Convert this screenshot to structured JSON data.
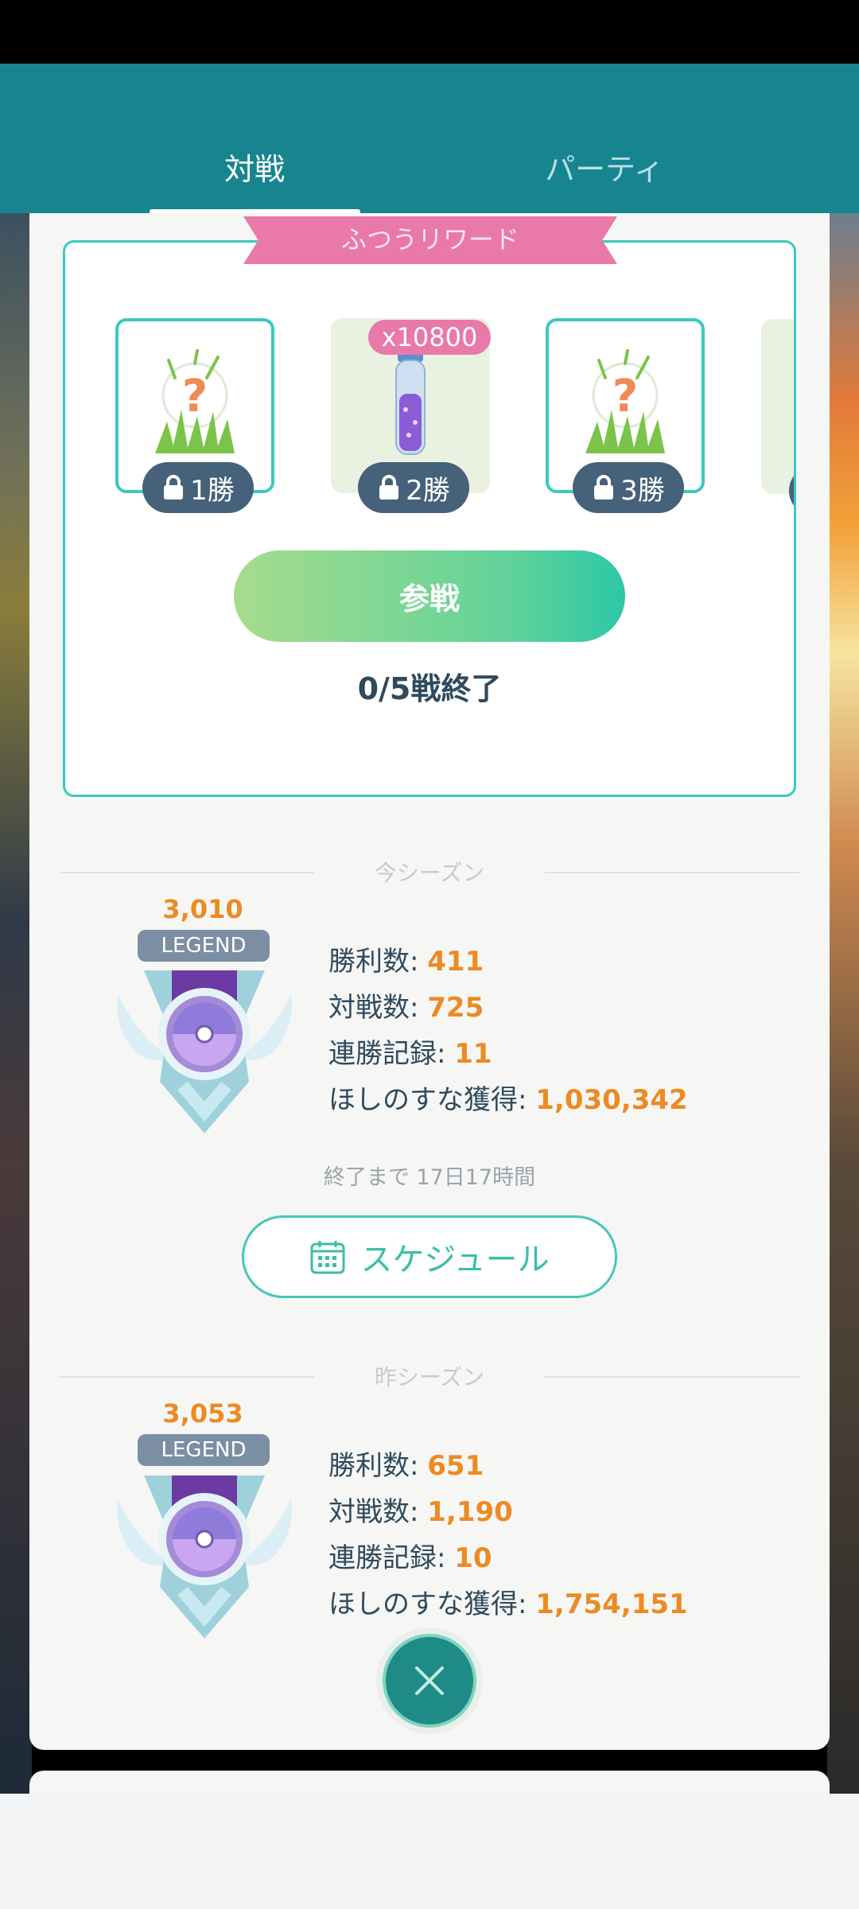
{
  "tabs": {
    "battle": "対戦",
    "party": "パーティ"
  },
  "rewards": {
    "ribbon": "ふつうリワード",
    "count_badge": "x10800",
    "items": [
      {
        "icon": "mystery-encounter-icon",
        "lock_label": "1勝"
      },
      {
        "icon": "stardust-icon",
        "lock_label": "2勝"
      },
      {
        "icon": "mystery-encounter-icon",
        "lock_label": "3勝"
      }
    ],
    "join_button": "参戦",
    "progress": "0/5戦終了"
  },
  "current_season": {
    "title": "今シーズン",
    "rating": "3,010",
    "rank": "LEGEND",
    "stats": [
      {
        "label": "勝利数: ",
        "value": "411"
      },
      {
        "label": "対戦数: ",
        "value": "725"
      },
      {
        "label": "連勝記録: ",
        "value": "11"
      },
      {
        "label": "ほしのすな獲得: ",
        "value": "1,030,342"
      }
    ],
    "ends_in": "終了まで 17日17時間",
    "schedule_button": "スケジュール"
  },
  "previous_season": {
    "title": "昨シーズン",
    "rating": "3,053",
    "rank": "LEGEND",
    "stats": [
      {
        "label": "勝利数: ",
        "value": "651"
      },
      {
        "label": "対戦数: ",
        "value": "1,190"
      },
      {
        "label": "連勝記録: ",
        "value": "10"
      },
      {
        "label": "ほしのすな獲得: ",
        "value": "1,754,151"
      }
    ]
  },
  "colors": {
    "header": "#16858f",
    "accent": "#3bc9c0",
    "orange": "#ec8a24",
    "ribbon": "#e879a8"
  }
}
